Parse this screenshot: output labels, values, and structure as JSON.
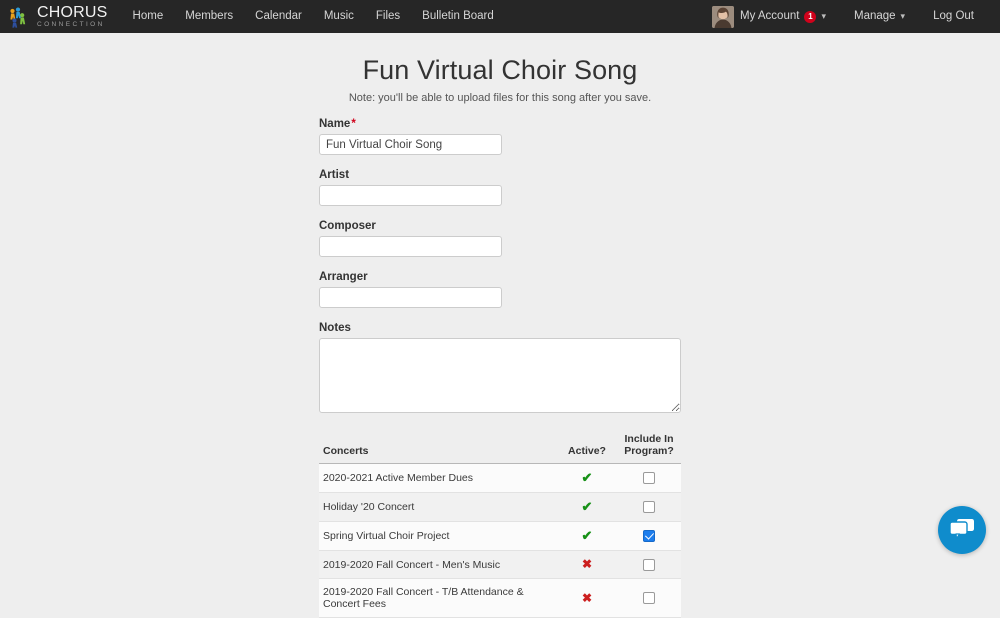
{
  "navbar": {
    "brand": {
      "icon": "chorus-people-logo-icon",
      "title": "CHORUS",
      "subtitle": "CONNECTION"
    },
    "links": [
      {
        "label": "Home"
      },
      {
        "label": "Members"
      },
      {
        "label": "Calendar"
      },
      {
        "label": "Music"
      },
      {
        "label": "Files"
      },
      {
        "label": "Bulletin Board"
      }
    ],
    "account": {
      "avatar_icon": "user-avatar-photo",
      "label": "My Account",
      "badge": "1",
      "caret": "▾"
    },
    "manage": {
      "label": "Manage",
      "caret": "▾"
    },
    "logout": {
      "label": "Log Out"
    }
  },
  "page": {
    "title": "Fun Virtual Choir Song",
    "note": "Note: you'll be able to upload files for this song after you save."
  },
  "form": {
    "name": {
      "label": "Name",
      "required_marker": "*",
      "value": "Fun Virtual Choir Song",
      "placeholder": ""
    },
    "artist": {
      "label": "Artist",
      "value": "",
      "placeholder": ""
    },
    "composer": {
      "label": "Composer",
      "value": "",
      "placeholder": ""
    },
    "arranger": {
      "label": "Arranger",
      "value": "",
      "placeholder": ""
    },
    "notes": {
      "label": "Notes",
      "value": "",
      "placeholder": ""
    }
  },
  "concerts_table": {
    "headers": {
      "concerts": "Concerts",
      "active": "Active?",
      "include_line1": "Include In",
      "include_line2": "Program?"
    },
    "rows": [
      {
        "name": "2020-2021 Active Member Dues",
        "active": true,
        "active_glyph": "✔",
        "include": false
      },
      {
        "name": "Holiday '20 Concert",
        "active": true,
        "active_glyph": "✔",
        "include": false
      },
      {
        "name": "Spring Virtual Choir Project",
        "active": true,
        "active_glyph": "✔",
        "include": true
      },
      {
        "name": "2019-2020 Fall Concert - Men's Music",
        "active": false,
        "active_glyph": "✖",
        "include": false
      },
      {
        "name": "2019-2020 Fall Concert - T/B Attendance & Concert Fees",
        "active": false,
        "active_glyph": "✖",
        "include": false
      }
    ]
  },
  "chat_widget": {
    "icon": "chat-bubble-icon"
  },
  "colors": {
    "navbar_bg": "#262626",
    "page_bg": "#eeeeee",
    "accent_blue": "#1c7ded",
    "chat_blue": "#0f8ccc",
    "active_green": "#179117",
    "inactive_red": "#cc1f1f",
    "badge_red": "#d0021b"
  }
}
